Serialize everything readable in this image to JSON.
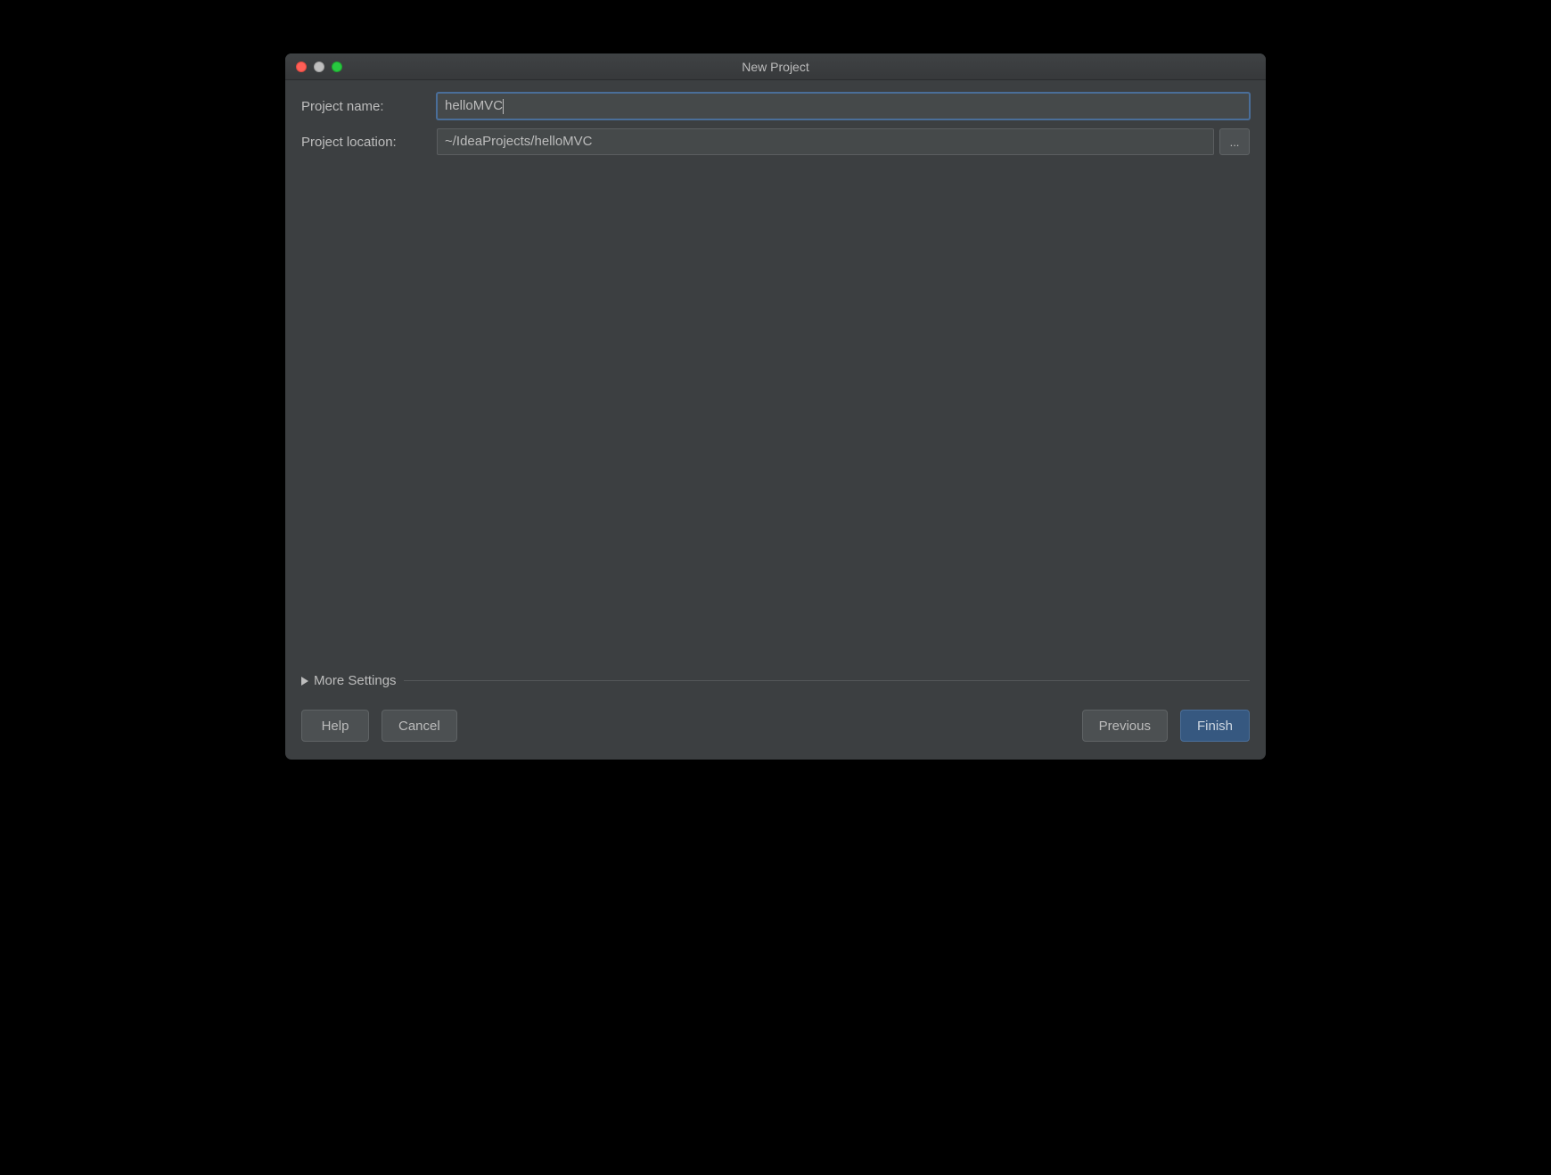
{
  "window": {
    "title": "New Project"
  },
  "form": {
    "project_name_label": "Project name:",
    "project_name_value": "helloMVC",
    "project_location_label": "Project location:",
    "project_location_value": "~/IdeaProjects/helloMVC",
    "browse_label": "..."
  },
  "more_settings": {
    "label": "More Settings",
    "expanded": false
  },
  "buttons": {
    "help": "Help",
    "cancel": "Cancel",
    "previous": "Previous",
    "finish": "Finish"
  }
}
